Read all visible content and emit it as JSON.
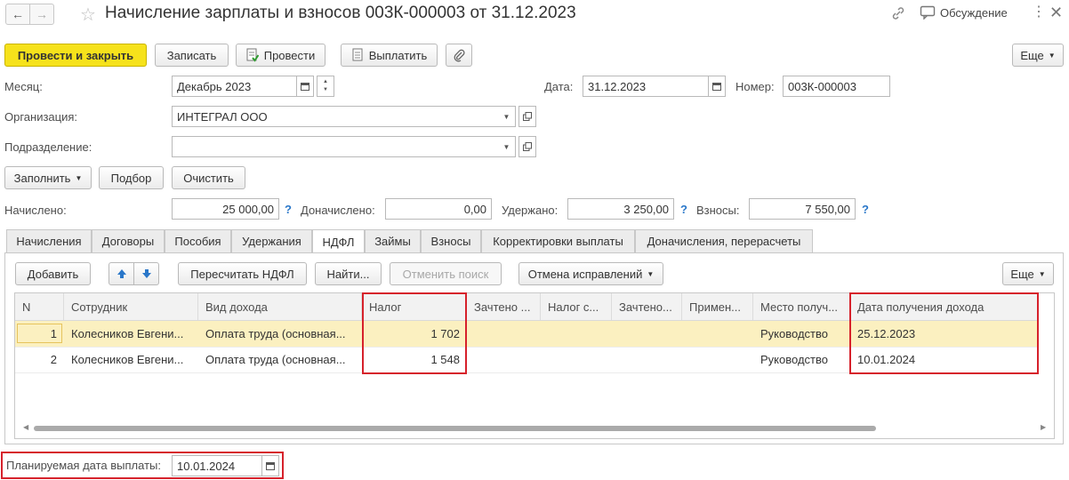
{
  "window": {
    "title": "Начисление зарплаты и взносов 003К-000003 от 31.12.2023",
    "discussion_label": "Обсуждение"
  },
  "toolbar": {
    "post_close_label": "Провести и закрыть",
    "write_label": "Записать",
    "post_label": "Провести",
    "pay_label": "Выплатить",
    "more_label": "Еще"
  },
  "form": {
    "month_label": "Месяц:",
    "month_value": "Декабрь 2023",
    "date_label": "Дата:",
    "date_value": "31.12.2023",
    "number_label": "Номер:",
    "number_value": "003К-000003",
    "org_label": "Организация:",
    "org_value": "ИНТЕГРАЛ ООО",
    "dept_label": "Подразделение:",
    "dept_value": ""
  },
  "actions": {
    "fill_label": "Заполнить",
    "select_label": "Подбор",
    "clear_label": "Очистить"
  },
  "totals": {
    "accrued_label": "Начислено:",
    "accrued_value": "25 000,00",
    "additional_label": "Доначислено:",
    "additional_value": "0,00",
    "withheld_label": "Удержано:",
    "withheld_value": "3 250,00",
    "contributions_label": "Взносы:",
    "contributions_value": "7 550,00",
    "help_mark": "?"
  },
  "tabs": [
    {
      "label": "Начисления"
    },
    {
      "label": "Договоры"
    },
    {
      "label": "Пособия"
    },
    {
      "label": "Удержания"
    },
    {
      "label": "НДФЛ"
    },
    {
      "label": "Займы"
    },
    {
      "label": "Взносы"
    },
    {
      "label": "Корректировки выплаты"
    },
    {
      "label": "Доначисления, перерасчеты"
    }
  ],
  "active_tab": "НДФЛ",
  "ndfl_toolbar": {
    "add_label": "Добавить",
    "recalc_label": "Пересчитать НДФЛ",
    "find_label": "Найти...",
    "cancel_search_label": "Отменить поиск",
    "undo_fix_label": "Отмена исправлений",
    "more_label": "Еще"
  },
  "table": {
    "columns": [
      "N",
      "Сотрудник",
      "Вид дохода",
      "Налог",
      "Зачтено ...",
      "Налог с...",
      "Зачтено...",
      "Примен...",
      "Место получ...",
      "Дата получения дохода"
    ],
    "rows": [
      {
        "n": "1",
        "employee": "Колесников Евгени...",
        "income_type": "Оплата труда (основная...",
        "tax": "1 702",
        "place": "Руководство",
        "date": "25.12.2023"
      },
      {
        "n": "2",
        "employee": "Колесников Евгени...",
        "income_type": "Оплата труда (основная...",
        "tax": "1 548",
        "place": "Руководство",
        "date": "10.01.2024"
      }
    ]
  },
  "footer": {
    "planned_pay_date_label": "Планируемая дата выплаты:",
    "planned_pay_date_value": "10.01.2024"
  },
  "colors": {
    "primary_button": "#f6e21b",
    "selected_row": "#fbf0c0",
    "highlight_frame": "#d6212b",
    "help_mark": "#2a77c9"
  }
}
